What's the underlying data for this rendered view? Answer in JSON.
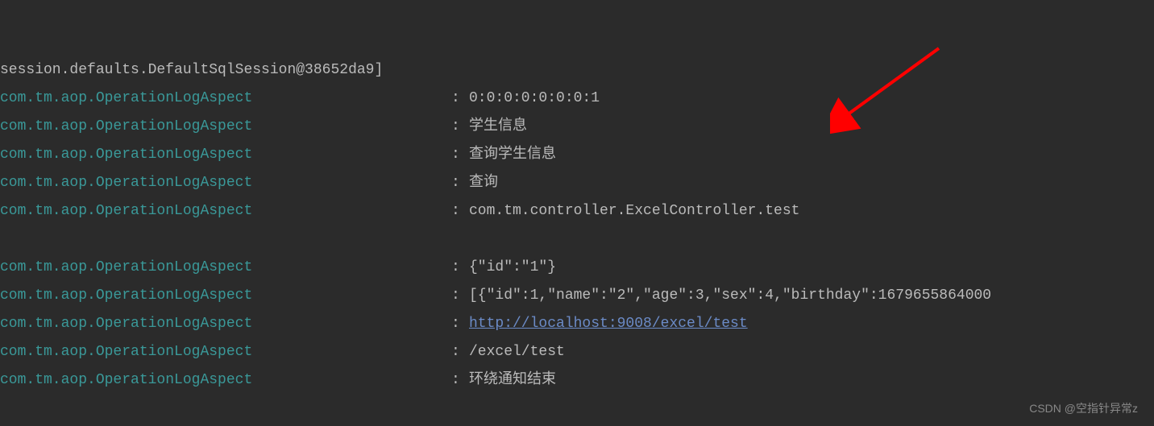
{
  "firstLine": "session.defaults.DefaultSqlSession@38652da9]",
  "logLines": [
    {
      "source": "com.tm.aop.OperationLogAspect",
      "sep": ":",
      "message": "0:0:0:0:0:0:0:1",
      "isLink": false
    },
    {
      "source": "com.tm.aop.OperationLogAspect",
      "sep": ":",
      "message": "学生信息",
      "isLink": false
    },
    {
      "source": "com.tm.aop.OperationLogAspect",
      "sep": ":",
      "message": "查询学生信息",
      "isLink": false
    },
    {
      "source": "com.tm.aop.OperationLogAspect",
      "sep": ":",
      "message": "查询",
      "isLink": false
    },
    {
      "source": "com.tm.aop.OperationLogAspect",
      "sep": ":",
      "message": "com.tm.controller.ExcelController.test",
      "isLink": false
    }
  ],
  "logLines2": [
    {
      "source": "com.tm.aop.OperationLogAspect",
      "sep": ":",
      "message": "{\"id\":\"1\"}",
      "isLink": false
    },
    {
      "source": "com.tm.aop.OperationLogAspect",
      "sep": ":",
      "message": "[{\"id\":1,\"name\":\"2\",\"age\":3,\"sex\":4,\"birthday\":1679655864000",
      "isLink": false
    },
    {
      "source": "com.tm.aop.OperationLogAspect",
      "sep": ":",
      "message": "http://localhost:9008/excel/test",
      "isLink": true
    },
    {
      "source": "com.tm.aop.OperationLogAspect",
      "sep": ":",
      "message": "/excel/test",
      "isLink": false
    },
    {
      "source": "com.tm.aop.OperationLogAspect",
      "sep": ":",
      "message": "环绕通知结束",
      "isLink": false
    }
  ],
  "watermark": "CSDN @空指针异常z"
}
